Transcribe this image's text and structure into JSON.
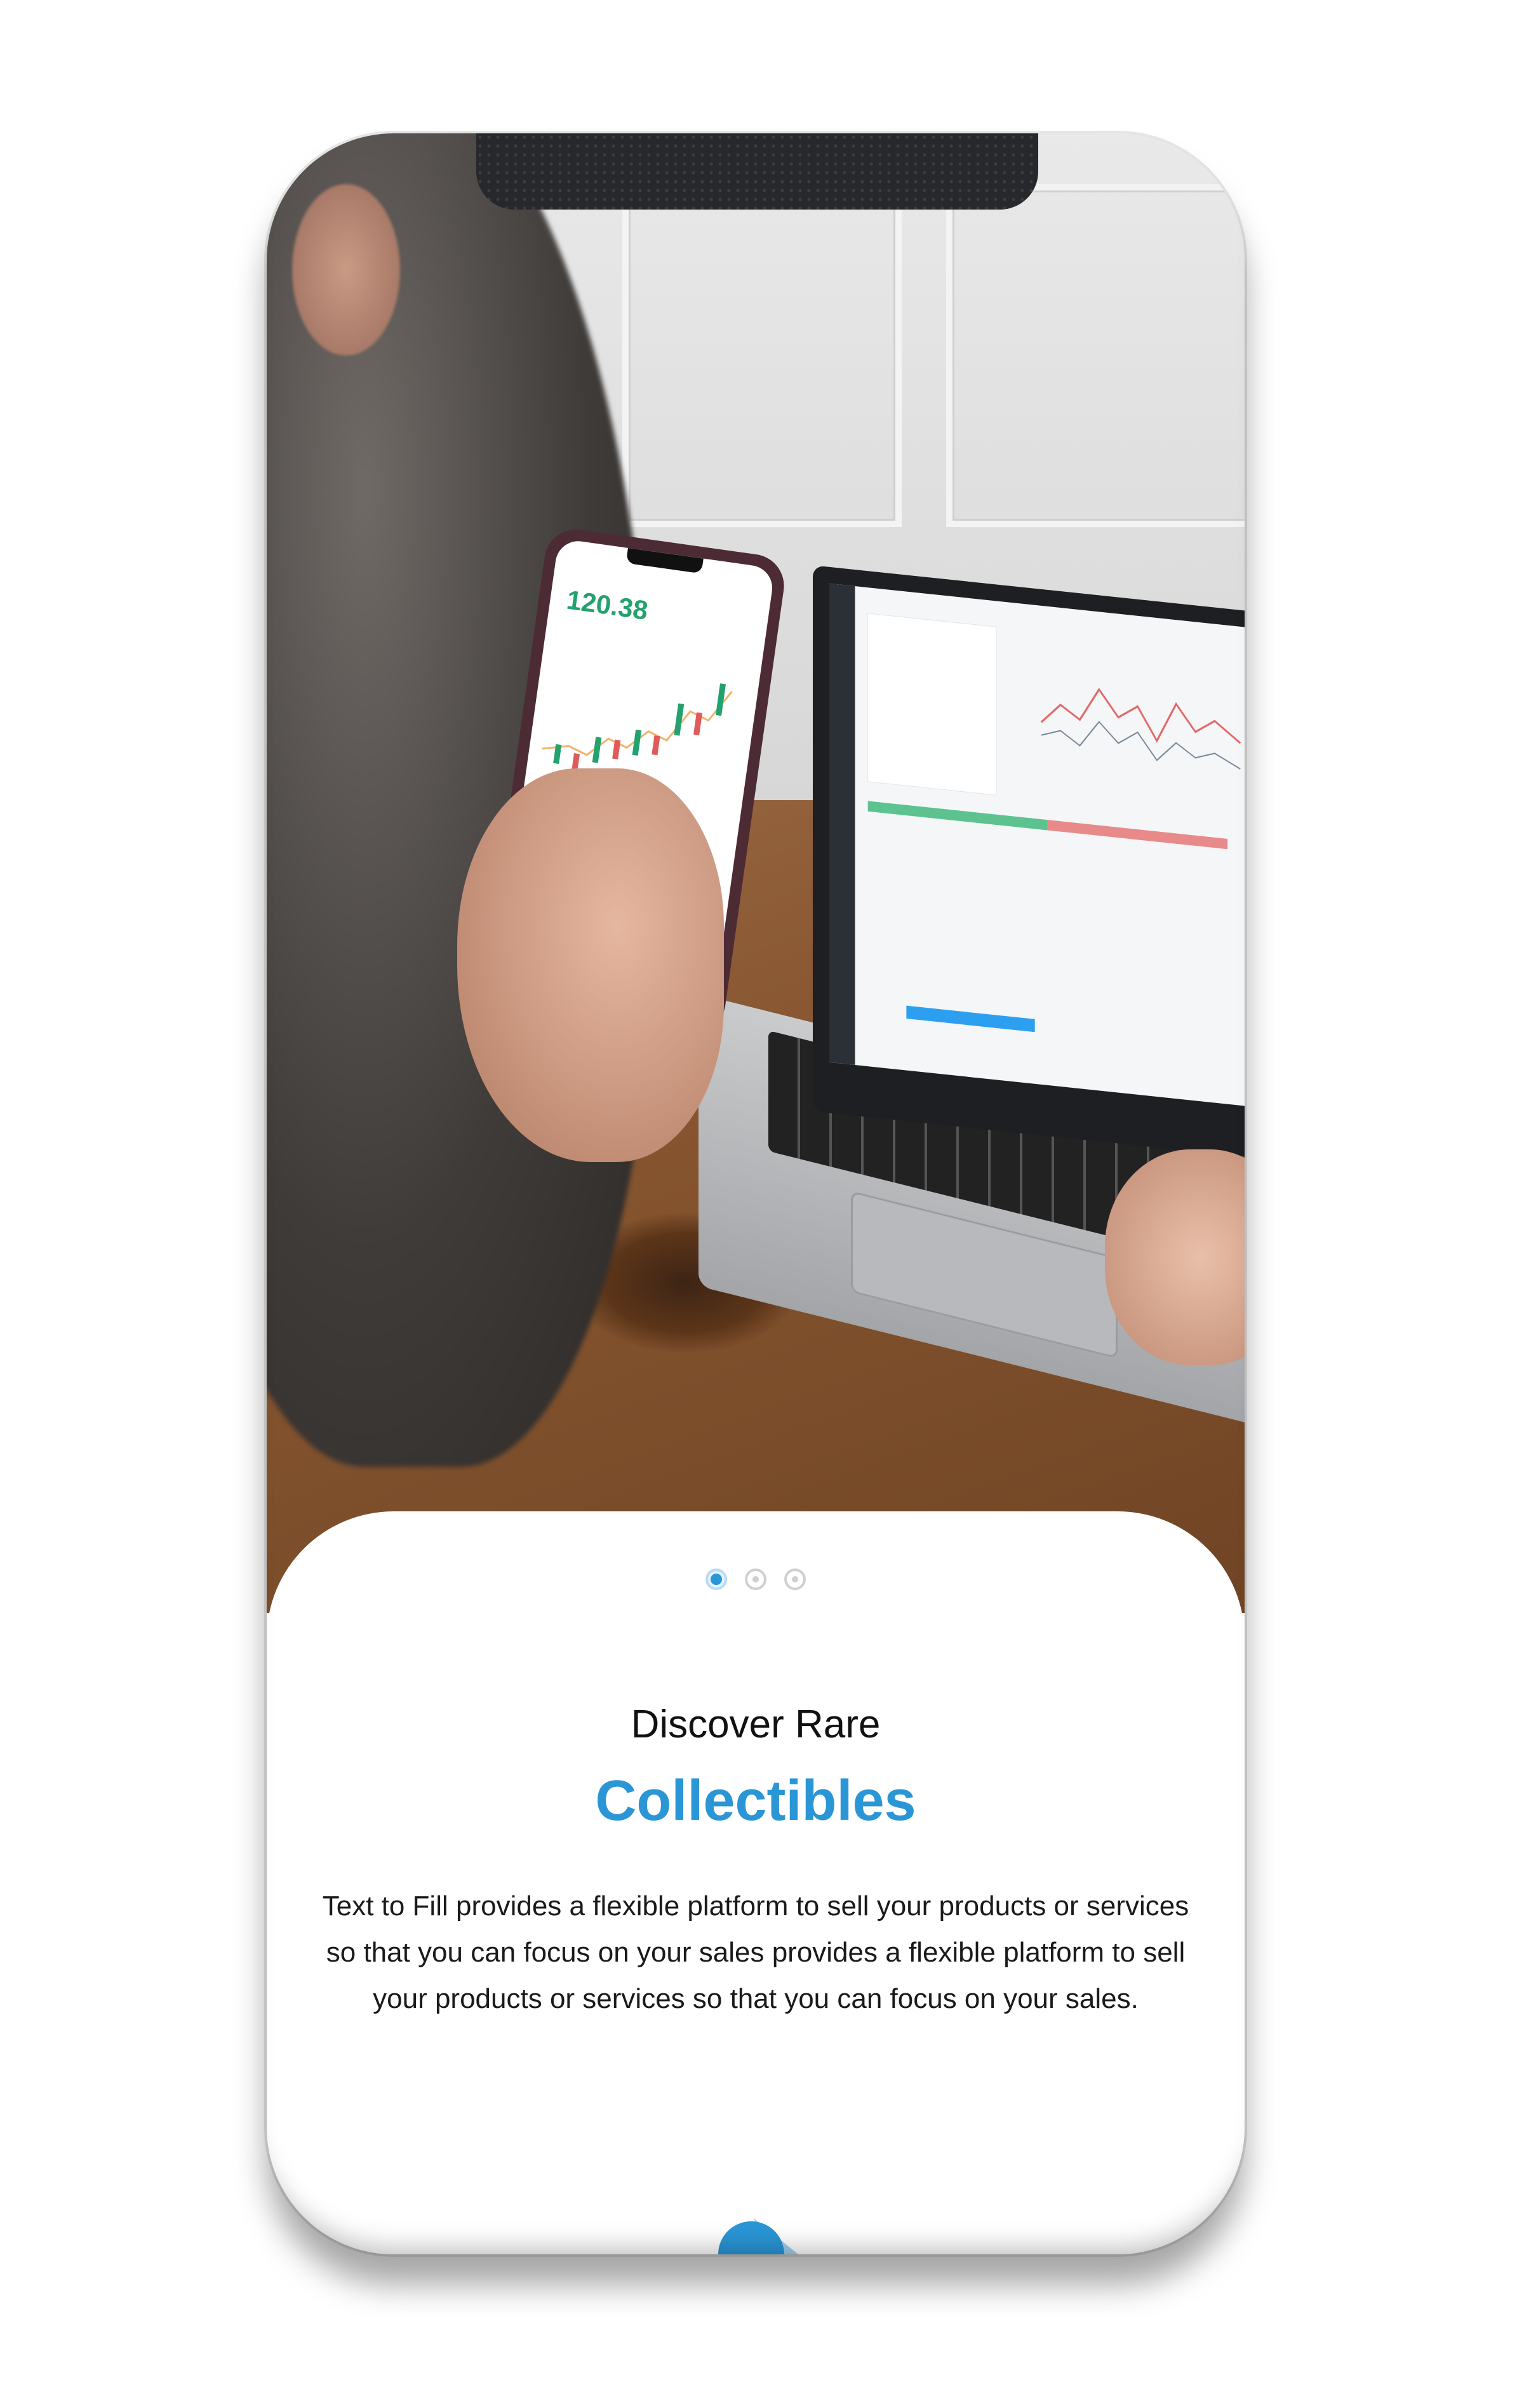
{
  "onboarding": {
    "pager": {
      "total": 3,
      "active_index": 0
    },
    "subtitle": "Discover Rare",
    "title": "Collectibles",
    "description": "Text to Fill provides a flexible platform to sell your products or services so that you can focus on your sales provides a flexible platform to sell your products or services so that you can focus on your sales.",
    "next_button": {
      "icon": "arrow-right-circle-icon"
    }
  },
  "hero_photo": {
    "phone_price": "120.38"
  },
  "colors": {
    "accent": "#2a96d6",
    "text": "#1a1a1a",
    "inactive_dot": "#cfcfcf"
  }
}
